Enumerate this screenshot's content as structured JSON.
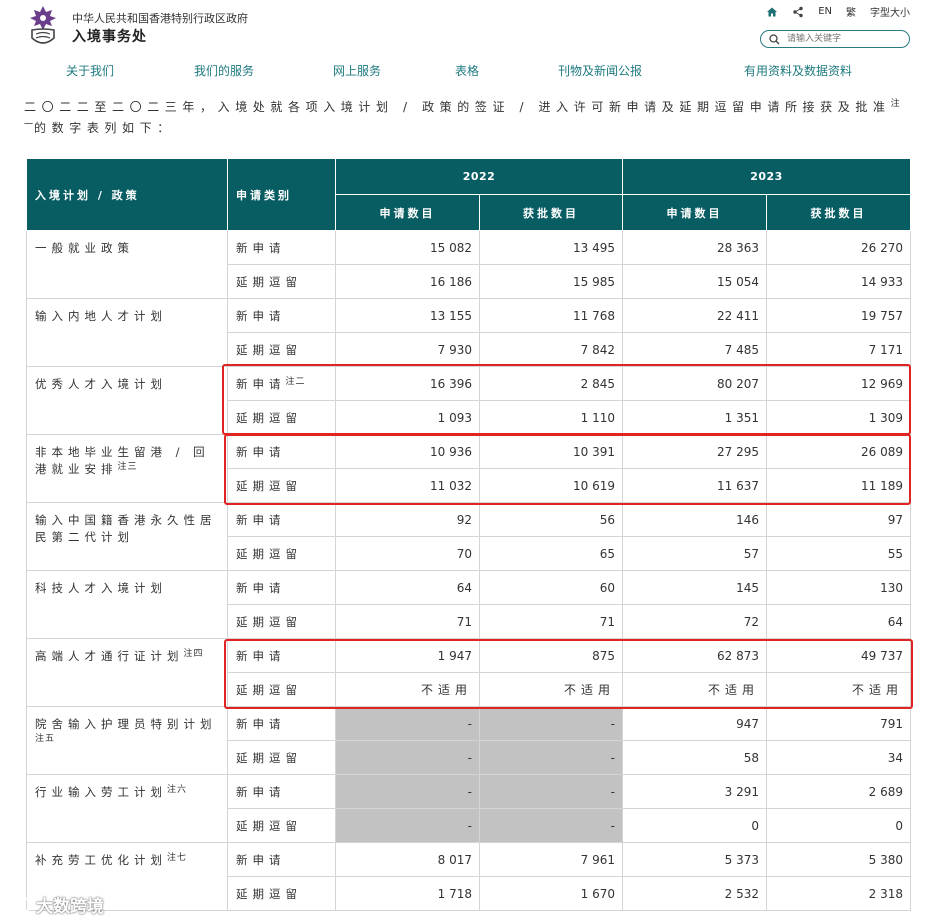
{
  "header": {
    "gov_name": "中华人民共和国香港特别行政区政府",
    "dept_name": "入境事务处",
    "utils": {
      "lang_en": "EN",
      "lang_sc": "繁",
      "font_size": "字型大小"
    },
    "search_placeholder": "请输入关键字"
  },
  "nav": [
    "关于我们",
    "我们的服务",
    "网上服务",
    "表格",
    "刊物及新闻公报",
    "有用资料及数据资料"
  ],
  "intro": {
    "text": "二〇二二至二〇二三年，入境处就各项入境计划 / 政策的签证 / 进入许可新申请及延期逗留申请所接获及批准",
    "note": "注一",
    "text2": "的数字表列如下："
  },
  "table": {
    "h_scheme": "入境计划 / 政策",
    "h_category": "申请类别",
    "years": [
      "2022",
      "2023"
    ],
    "sub_applied": "申请数目",
    "sub_approved": "获批数目",
    "rows": [
      {
        "scheme": "一般就业政策",
        "scheme_note": "",
        "new": {
          "label": "新申请",
          "note": "",
          "values": [
            "15 082",
            "13 495",
            "28 363",
            "26 270"
          ]
        },
        "ext": {
          "label": "延期逗留",
          "values": [
            "16 186",
            "15 985",
            "15 054",
            "14 933"
          ]
        }
      },
      {
        "scheme": "输入内地人才计划",
        "scheme_note": "",
        "new": {
          "label": "新申请",
          "note": "",
          "values": [
            "13 155",
            "11 768",
            "22 411",
            "19 757"
          ]
        },
        "ext": {
          "label": "延期逗留",
          "values": [
            "7 930",
            "7 842",
            "7 485",
            "7 171"
          ]
        }
      },
      {
        "scheme": "优秀人才入境计划",
        "scheme_note": "",
        "new": {
          "label": "新申请",
          "note": "注二",
          "values": [
            "16 396",
            "2 845",
            "80 207",
            "12 969"
          ]
        },
        "ext": {
          "label": "延期逗留",
          "values": [
            "1 093",
            "1 110",
            "1 351",
            "1 309"
          ]
        }
      },
      {
        "scheme": "非本地毕业生留港 / 回港就业安排",
        "scheme_note": "注三",
        "new": {
          "label": "新申请",
          "note": "",
          "values": [
            "10 936",
            "10 391",
            "27 295",
            "26 089"
          ]
        },
        "ext": {
          "label": "延期逗留",
          "values": [
            "11 032",
            "10 619",
            "11 637",
            "11 189"
          ]
        }
      },
      {
        "scheme": "输入中国籍香港永久性居民第二代计划",
        "scheme_note": "",
        "new": {
          "label": "新申请",
          "note": "",
          "values": [
            "92",
            "56",
            "146",
            "97"
          ]
        },
        "ext": {
          "label": "延期逗留",
          "values": [
            "70",
            "65",
            "57",
            "55"
          ]
        }
      },
      {
        "scheme": "科技人才入境计划",
        "scheme_note": "",
        "new": {
          "label": "新申请",
          "note": "",
          "values": [
            "64",
            "60",
            "145",
            "130"
          ]
        },
        "ext": {
          "label": "延期逗留",
          "values": [
            "71",
            "71",
            "72",
            "64"
          ]
        }
      },
      {
        "scheme": "高端人才通行证计划",
        "scheme_note": "注四",
        "new": {
          "label": "新申请",
          "note": "",
          "values": [
            "1 947",
            "875",
            "62 873",
            "49 737"
          ]
        },
        "ext": {
          "label": "延期逗留",
          "values": [
            "不适用",
            "不适用",
            "不适用",
            "不适用"
          ]
        }
      },
      {
        "scheme": "院舍输入护理员特别计划",
        "scheme_note": "注五",
        "new": {
          "label": "新申请",
          "note": "",
          "values": [
            "-",
            "-",
            "947",
            "791"
          ]
        },
        "ext": {
          "label": "延期逗留",
          "values": [
            "-",
            "-",
            "58",
            "34"
          ]
        }
      },
      {
        "scheme": "行业输入劳工计划",
        "scheme_note": "注六",
        "new": {
          "label": "新申请",
          "note": "",
          "values": [
            "-",
            "-",
            "3 291",
            "2 689"
          ]
        },
        "ext": {
          "label": "延期逗留",
          "values": [
            "-",
            "-",
            "0",
            "0"
          ]
        }
      },
      {
        "scheme": "补充劳工优化计划",
        "scheme_note": "注七",
        "new": {
          "label": "新申请",
          "note": "",
          "values": [
            "8 017",
            "7 961",
            "5 373",
            "5 380"
          ]
        },
        "ext": {
          "label": "延期逗留",
          "values": [
            "1 718",
            "1 670",
            "2 532",
            "2 318"
          ]
        }
      }
    ]
  },
  "watermark": "大数跨境",
  "colors": {
    "header_teal": "#085d63",
    "nav_link": "#1e7a7f",
    "highlight_red": "#e02323",
    "grey_cell": "#c2c2c2"
  }
}
